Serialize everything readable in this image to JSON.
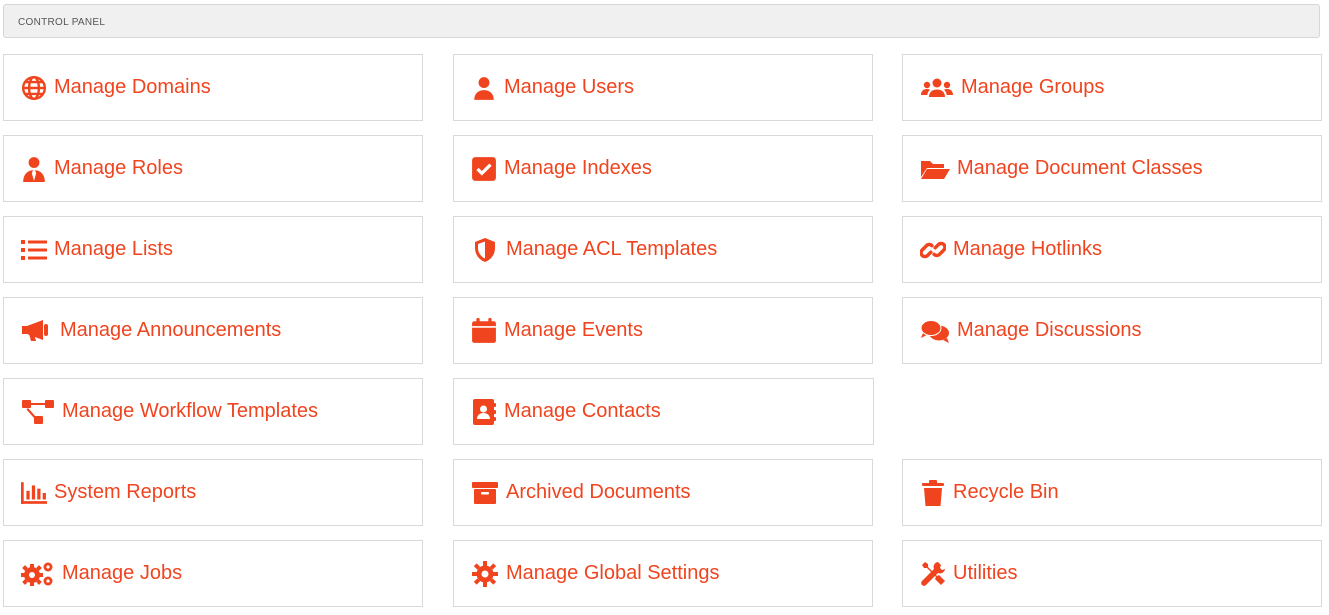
{
  "header": {
    "title": "CONTROL PANEL"
  },
  "accent_color": "#f0441f",
  "tiles": [
    {
      "label": "Manage Domains",
      "icon": "globe-icon"
    },
    {
      "label": "Manage Users",
      "icon": "user-icon"
    },
    {
      "label": "Manage Groups",
      "icon": "users-icon"
    },
    {
      "label": "Manage Roles",
      "icon": "user-tie-icon"
    },
    {
      "label": "Manage Indexes",
      "icon": "check-square-icon"
    },
    {
      "label": "Manage Document Classes",
      "icon": "folder-open-icon"
    },
    {
      "label": "Manage Lists",
      "icon": "list-icon"
    },
    {
      "label": "Manage ACL Templates",
      "icon": "shield-icon"
    },
    {
      "label": "Manage Hotlinks",
      "icon": "link-icon"
    },
    {
      "label": "Manage Announcements",
      "icon": "bullhorn-icon"
    },
    {
      "label": "Manage Events",
      "icon": "calendar-icon"
    },
    {
      "label": "Manage Discussions",
      "icon": "comments-icon"
    },
    {
      "label": "Manage Workflow Templates",
      "icon": "project-diagram-icon"
    },
    {
      "label": "Manage Contacts",
      "icon": "address-book-icon"
    },
    {
      "label": "System Reports",
      "icon": "chart-bar-icon"
    },
    {
      "label": "Archived Documents",
      "icon": "archive-icon"
    },
    {
      "label": "Recycle Bin",
      "icon": "trash-icon"
    },
    {
      "label": "Manage Jobs",
      "icon": "cogs-icon"
    },
    {
      "label": "Manage Global Settings",
      "icon": "cog-icon"
    },
    {
      "label": "Utilities",
      "icon": "tools-icon"
    }
  ]
}
